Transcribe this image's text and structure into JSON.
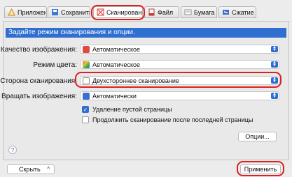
{
  "tabs": [
    {
      "label": "Приложение",
      "icon": "app-icon",
      "color": "#e2a328"
    },
    {
      "label": "Сохранить",
      "icon": "save-icon",
      "color": "#3f78d6"
    },
    {
      "label": "Сканирование",
      "icon": "scan-icon",
      "color": "#d23b2f"
    },
    {
      "label": "Файл",
      "icon": "file-icon",
      "color": "#c0392b"
    },
    {
      "label": "Бумага",
      "icon": "paper-icon",
      "color": "#8d8d8d"
    },
    {
      "label": "Сжатие",
      "icon": "compression-icon",
      "color": "#3a6fcf"
    }
  ],
  "active_tab": "Сканирование",
  "banner": "Задайте режим сканирования и опции.",
  "settings": {
    "quality": {
      "label": "Качество изображения:",
      "value": "Автоматическое"
    },
    "color_mode": {
      "label": "Режим цвета:",
      "value": "Автоматическое"
    },
    "side": {
      "label": "Сторона сканирования:",
      "value": "Двухстороннее сканирование"
    },
    "rotate": {
      "label": "Вращать изображения:",
      "value": "Автоматически"
    }
  },
  "checkboxes": [
    {
      "label": "Удаление пустой страницы",
      "checked": true
    },
    {
      "label": "Продолжить сканирование после последней страницы",
      "checked": false
    }
  ],
  "options_button": "Опции...",
  "help_label": "?",
  "hide_button": "Скрыть",
  "apply_button": "Применить",
  "colors": {
    "accent": "#2f6fd0",
    "highlight": "#e0201e"
  }
}
